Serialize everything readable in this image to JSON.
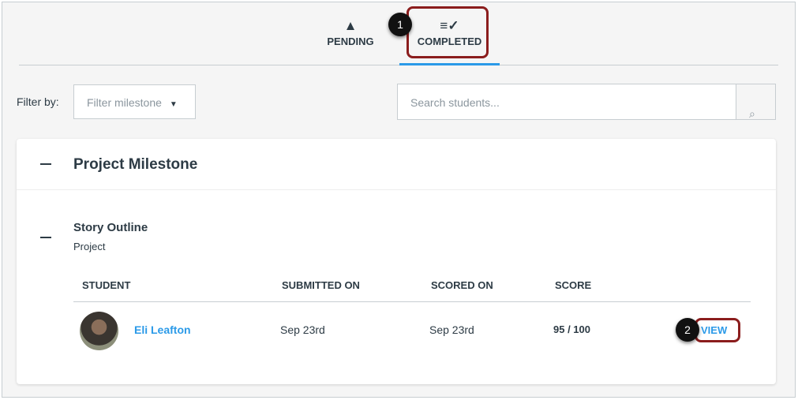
{
  "tabs": [
    {
      "label": "PENDING",
      "icon": "warning-icon"
    },
    {
      "label": "COMPLETED",
      "icon": "list-check-icon"
    }
  ],
  "callouts": [
    "1",
    "2"
  ],
  "filter": {
    "label": "Filter by:",
    "placeholder": "Filter milestone"
  },
  "search": {
    "placeholder": "Search students..."
  },
  "milestone": {
    "title": "Project Milestone",
    "assignment": {
      "title": "Story Outline",
      "type": "Project"
    }
  },
  "table": {
    "headers": [
      "STUDENT",
      "SUBMITTED ON",
      "SCORED ON",
      "SCORE"
    ],
    "rows": [
      {
        "student": "Eli Leafton",
        "submitted": "Sep 23rd",
        "scored": "Sep 23rd",
        "score": "95 / 100",
        "action": "VIEW"
      }
    ]
  },
  "colors": {
    "accent": "#2b9ae8",
    "highlight": "#8b1d1d"
  }
}
